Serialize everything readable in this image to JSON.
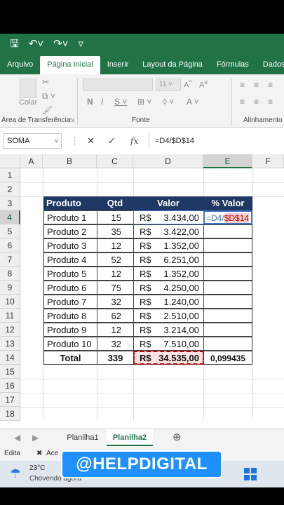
{
  "ribbon": {
    "tabs": [
      "Arquivo",
      "Página Inicial",
      "Inserir",
      "Layout da Página",
      "Fórmulas",
      "Dados"
    ],
    "active_tab": "Página Inicial",
    "groups": {
      "clipboard": "Área de Transferência",
      "font": "Fonte",
      "alignment": "Alinhamento"
    },
    "paste_label": "Colar",
    "font_size": "11"
  },
  "formula_bar": {
    "name_box": "SOMA",
    "cancel_icon": "✕",
    "enter_icon": "✓",
    "fx_icon": "fx",
    "formula": "=D4/$D$14"
  },
  "grid": {
    "columns": [
      "A",
      "B",
      "C",
      "D",
      "E",
      "F"
    ],
    "rows": [
      "1",
      "2",
      "3",
      "4",
      "5",
      "6",
      "7",
      "8",
      "9",
      "10",
      "11",
      "12",
      "13",
      "14",
      "15",
      "16",
      "17",
      "18"
    ]
  },
  "table": {
    "headers": {
      "product": "Produto",
      "qty": "Qtd",
      "value": "Valor",
      "pct": "% Valor"
    },
    "rows": [
      {
        "product": "Produto 1",
        "qty": "15",
        "cur": "R$",
        "amount": "3.434,00"
      },
      {
        "product": "Produto 2",
        "qty": "35",
        "cur": "R$",
        "amount": "3.422,00"
      },
      {
        "product": "Produto 3",
        "qty": "12",
        "cur": "R$",
        "amount": "1.352,00"
      },
      {
        "product": "Produto 4",
        "qty": "52",
        "cur": "R$",
        "amount": "6.251,00"
      },
      {
        "product": "Produto 5",
        "qty": "12",
        "cur": "R$",
        "amount": "1.352,00"
      },
      {
        "product": "Produto 6",
        "qty": "75",
        "cur": "R$",
        "amount": "4.250,00"
      },
      {
        "product": "Produto 7",
        "qty": "32",
        "cur": "R$",
        "amount": "1.240,00"
      },
      {
        "product": "Produto 8",
        "qty": "62",
        "cur": "R$",
        "amount": "2.510,00"
      },
      {
        "product": "Produto 9",
        "qty": "12",
        "cur": "R$",
        "amount": "3.214,00"
      },
      {
        "product": "Produto 10",
        "qty": "32",
        "cur": "R$",
        "amount": "7.510,00"
      }
    ],
    "total": {
      "label": "Total",
      "qty": "339",
      "cur": "R$",
      "amount": "34.535,00",
      "pct": "0,099435"
    },
    "editing_cell": {
      "text_part1": "=D4/",
      "text_part2": "$D$14"
    }
  },
  "sheets": {
    "tabs": [
      "Planilha1",
      "Planilha2"
    ],
    "active": "Planilha2"
  },
  "status": {
    "mode": "Edita",
    "accessibility": "Ace"
  },
  "taskbar": {
    "temperature": "23°C",
    "condition": "Chovendo agora"
  },
  "watermark": "@HELPDIGITAL",
  "colors": {
    "excel_green": "#217346",
    "table_header": "#1f3864",
    "ref_red": "#c00000",
    "edit_blue": "#4472c4"
  }
}
